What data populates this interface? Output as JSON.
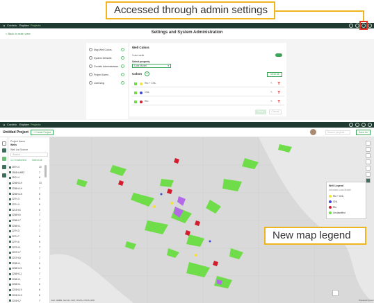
{
  "callouts": {
    "admin": "Accessed through admin settings",
    "legend": "New map legend"
  },
  "header": {
    "app_name": "Cordelo",
    "nav": [
      "Explore",
      "Projects"
    ]
  },
  "settings": {
    "back_link": "< Back to main view",
    "title": "Settings and System Administration",
    "nav_items": [
      "Map Well Colors",
      "System Defaults",
      "Cordelo Administrators",
      "Project Users",
      "Licensing"
    ],
    "section_title": "Well Colors",
    "color_wells_label": "Color wells",
    "select_property_label": "Select property",
    "select_property_value": "Loss Model",
    "colors_heading": "Colors",
    "clear_all": "Clear all",
    "color_rows": [
      {
        "label": "Rto + CNL",
        "color": "#f2e33b"
      },
      {
        "label": "CNL",
        "color": "#3f48d6"
      },
      {
        "label": "Rto",
        "color": "#d11d2c"
      }
    ],
    "save_label": "Save",
    "cancel_label": "Cancel"
  },
  "project": {
    "header_nav": [
      "Explore",
      "Projects"
    ],
    "title": "Untitled Project",
    "create_project": "+ Create Project",
    "search_placeholder": "Search projects",
    "save_as": "Save As",
    "project_name_label": "Project Name",
    "project_name_value": "Wells",
    "well_list_label": "Well List Source",
    "search_label": "Search...",
    "count_text": "1,174 selected",
    "select_all": "Select All",
    "wells": [
      "257H-4",
      "2503H-WRZ",
      "257H-4",
      "2236H-1H",
      "2236H-1H",
      "2236H-1N",
      "227H-3",
      "227H-3",
      "2212H-6",
      "2236H-6",
      "2236H-7",
      "2236H-1",
      "227H-3",
      "227H-7",
      "227H-6",
      "2237H-1",
      "2237H-7",
      "2237H-8",
      "2236H-1",
      "2236H-21",
      "2236H-11",
      "2236H-1",
      "2236H-1",
      "2215H-19",
      "2215H-1H",
      "2215H-2"
    ],
    "well_values": [
      "10",
      "7",
      "6",
      "13",
      "7",
      "8",
      "6",
      "6",
      "6",
      "7",
      "7",
      "7",
      "7",
      "6",
      "6",
      "7",
      "7",
      "7",
      "6",
      "6",
      "7",
      "7",
      "6",
      "6",
      "6",
      "7"
    ]
  },
  "legend": {
    "title": "Well Legend",
    "subtitle": "Unknown Loss Model",
    "items": [
      {
        "label": "Rto + CNL",
        "color": "#f2e33b"
      },
      {
        "label": "CNL",
        "color": "#3f48d6"
      },
      {
        "label": "Rto",
        "color": "#d11d2c"
      },
      {
        "label": "Unclassified",
        "color": "#6fdc4a"
      }
    ]
  },
  "map": {
    "attribution": "Esri, HERE, Garmin, FAO, NOAA, USGS, EPA",
    "powered_by": "Powered by Esri"
  }
}
